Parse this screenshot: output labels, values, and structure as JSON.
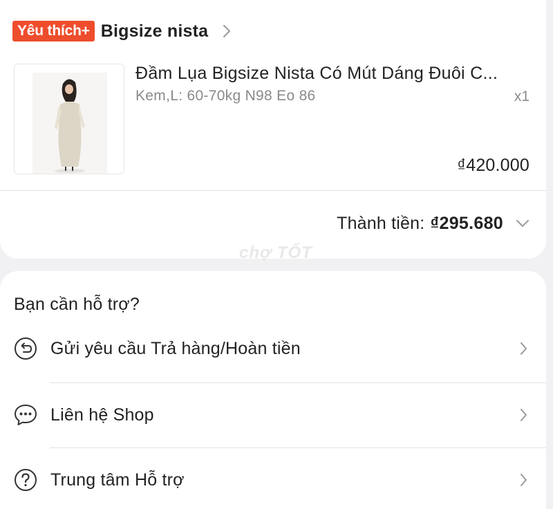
{
  "order": {
    "badge": "Yêu thích+",
    "shop_name": "Bigsize nista",
    "product": {
      "name": "Đầm Lụa Bigsize Nista Có Mút Dáng Đuôi C...",
      "variant": "Kem,L: 60-70kg N98 Eo 86",
      "quantity": "x1",
      "price": "₫420.000"
    },
    "total_label": "Thành tiền:",
    "total_value": "₫295.680",
    "watermark": "chợ TỐT"
  },
  "support": {
    "title": "Bạn cần hỗ trợ?",
    "items": [
      {
        "label": "Gửi yêu cầu Trả hàng/Hoàn tiền",
        "icon": "return-refund-icon"
      },
      {
        "label": "Liên hệ Shop",
        "icon": "chat-icon"
      },
      {
        "label": "Trung tâm Hỗ trợ",
        "icon": "help-icon"
      }
    ]
  },
  "colors": {
    "accent": "#ee4d2d",
    "background": "#f1f1f3",
    "card": "#ffffff",
    "muted_text": "#8a8a8a"
  }
}
